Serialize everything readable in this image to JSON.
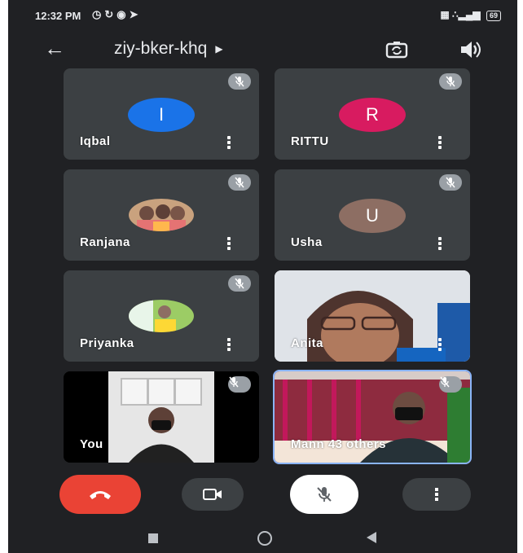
{
  "status_bar": {
    "time": "12:32 PM",
    "battery": "69"
  },
  "header": {
    "meeting_code": "ziy-bker-khq"
  },
  "participants": [
    {
      "name": "Iqbal",
      "initial": "I",
      "color": "#1a73e8"
    },
    {
      "name": "RITTU",
      "initial": "R",
      "color": "#d81b60"
    },
    {
      "name": "Ranjana"
    },
    {
      "name": "Usha",
      "initial": "U",
      "color": "#8d6e63"
    },
    {
      "name": "Priyanka"
    },
    {
      "name": "Anita"
    },
    {
      "name": "You"
    },
    {
      "name": "Mann 43 others"
    }
  ],
  "icons": {
    "back": "arrow-left-icon",
    "camera_switch": "camera-switch-icon",
    "speaker": "speaker-icon",
    "muted": "mic-off-icon",
    "more": "more-vert-icon",
    "hangup": "call-end-icon",
    "camera": "videocam-icon",
    "mic": "mic-off-icon"
  },
  "colors": {
    "background": "#202124",
    "tile": "#3c4043",
    "hangup": "#ea4335",
    "active_border": "#8ab4f8"
  }
}
